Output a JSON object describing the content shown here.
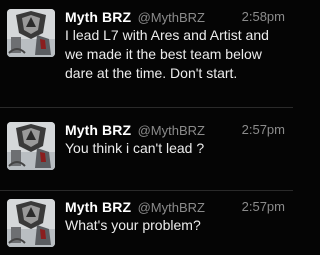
{
  "tweets": [
    {
      "name": "Myth BRZ",
      "handle": "@MythBRZ",
      "time": "2:58pm",
      "text": "I lead L7 with Ares and Artist and we made it the best team below dare at the time. Don't start.",
      "avatar_icon": "profile-avatar-icon",
      "avatar_badge": "BRZ"
    },
    {
      "name": "Myth BRZ",
      "handle": "@MythBRZ",
      "time": "2:57pm",
      "text": "You think i can't lead ?",
      "avatar_icon": "profile-avatar-icon",
      "avatar_badge": "BRZ"
    },
    {
      "name": "Myth BRZ",
      "handle": "@MythBRZ",
      "time": "2:57pm",
      "text": "What's your problem?",
      "avatar_icon": "profile-avatar-icon",
      "avatar_badge": "BRZ"
    }
  ],
  "colors": {
    "background": "#050505",
    "name": "#ffffff",
    "meta": "#8b8b8b",
    "text": "#ececec",
    "divider": "#2a2a2a"
  }
}
